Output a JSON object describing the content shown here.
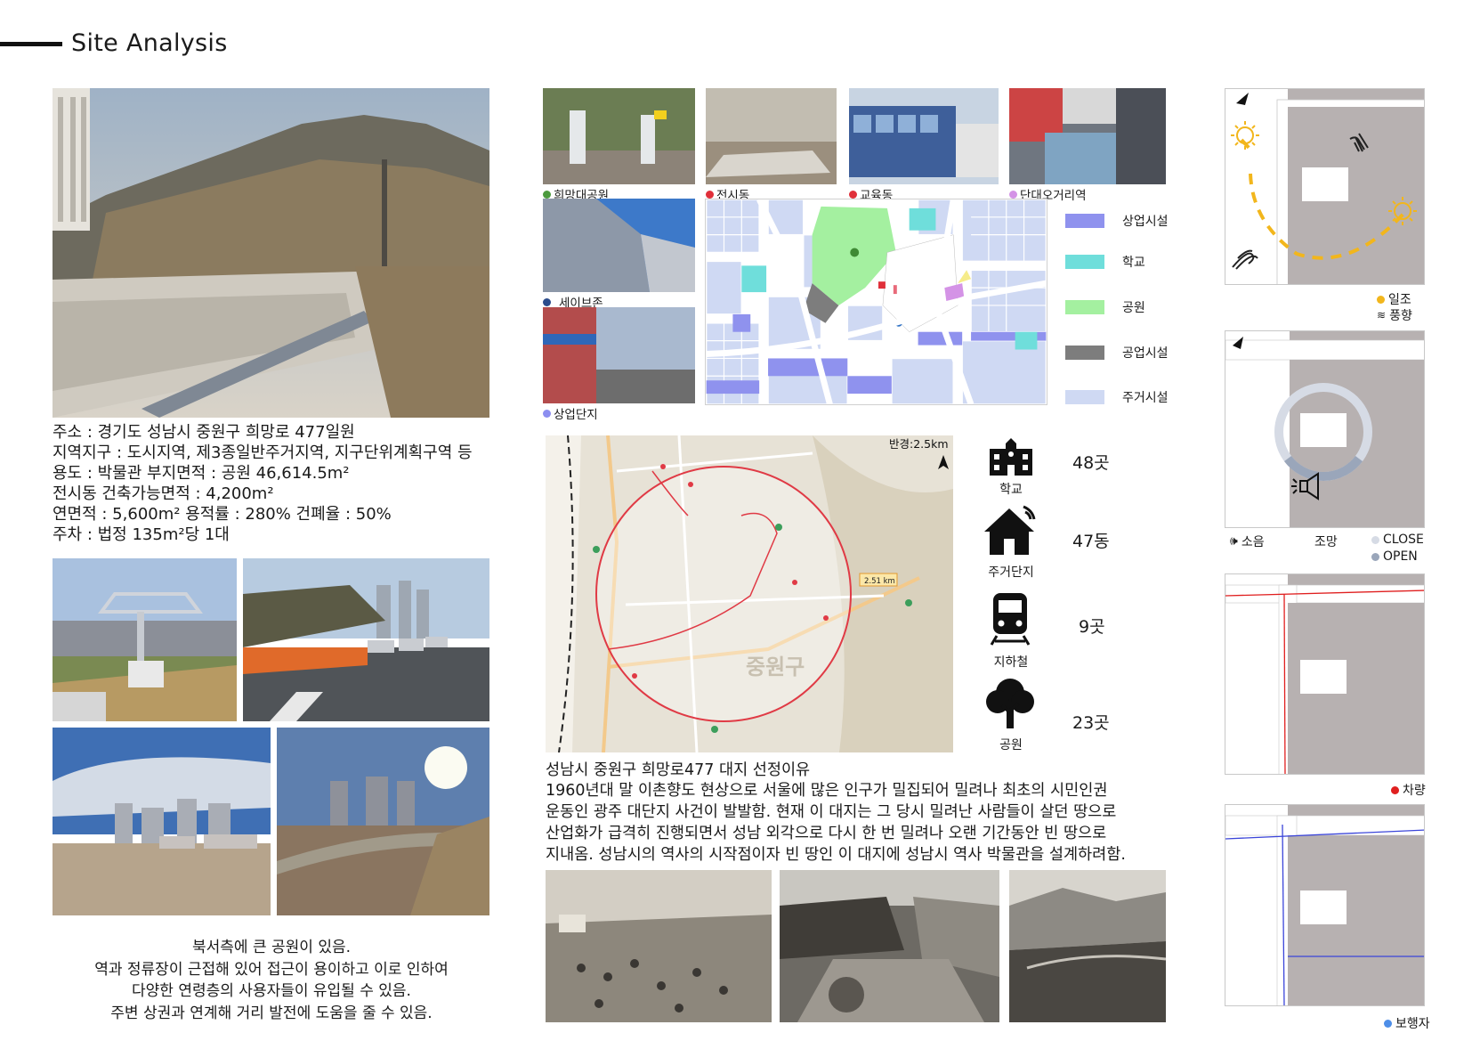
{
  "header": {
    "title": "Site Analysis"
  },
  "site_info": {
    "line1": "주소 : 경기도 성남시 중원구 희망로 477일원",
    "line2": "지역지구 : 도시지역, 제3종일반주거지역, 지구단위계획구역 등",
    "line3": "용도 : 박물관  부지면적 : 공원 46,614.5m²",
    "line4": "전시동 건축가능면적 : 4,200m²",
    "line5": "연면적 : 5,600m²    용적률 : 280%    건폐율 : 50%",
    "line6": "주차 : 법정 135m²당 1대"
  },
  "left_caption": {
    "line1": "북서측에 큰 공원이 있음.",
    "line2": "역과 정류장이 근접해 있어 접근이 용이하고 이로 인하여",
    "line3": "다양한 연령층의 사용자들이 유입될 수 있음.",
    "line4": "주변 상권과 연계해 거리 발전에 도움을 줄 수 있음."
  },
  "context_photos": {
    "p1": {
      "label": "희망대공원",
      "dot": "#4c9a3e"
    },
    "p2": {
      "label": "전시동",
      "dot": "#e0303a"
    },
    "p3": {
      "label": "교육동",
      "dot": "#e0303a"
    },
    "p4": {
      "label": "단대오거리역",
      "dot": "#d493e6"
    },
    "p5": {
      "label": "세이브존",
      "dot": "#2b4c8c"
    },
    "p6": {
      "label": "상업단지",
      "dot": "#8c8ef0"
    }
  },
  "landuse_legend": [
    {
      "label": "상업시설",
      "color": "#8f92ee"
    },
    {
      "label": "학교",
      "color": "#6fdedb"
    },
    {
      "label": "공원",
      "color": "#a4f0a0"
    },
    {
      "label": "공업시설",
      "color": "#7d7d7d"
    },
    {
      "label": "주거시설",
      "color": "#cfd9f3"
    }
  ],
  "radius_map": {
    "radius_label": "반경:2.5km",
    "distance_tag": "2.51 km",
    "district": "중원구"
  },
  "facilities": [
    {
      "label": "학교",
      "value": "48곳",
      "icon": "school-icon"
    },
    {
      "label": "주거단지",
      "value": "47동",
      "icon": "house-icon"
    },
    {
      "label": "지하철",
      "value": "9곳",
      "icon": "train-icon"
    },
    {
      "label": "공원",
      "value": "23곳",
      "icon": "tree-icon"
    }
  ],
  "reason": {
    "title": "성남시 중원구 희망로477 대지 선정이유",
    "line1": "1960년대 말 이촌향도 현상으로 서울에 많은 인구가 밀집되어 밀려나 최초의 시민인권",
    "line2": "운동인 광주 대단지 사건이 발발함. 현재 이 대지는 그 당시 밀려난 사람들이 살던 땅으로",
    "line3": "산업화가 급격히 진행되면서 성남 외각으로 다시 한 번 밀려나 오랜 기간동안 빈 땅으로",
    "line4": "지내옴. 성남시의 역사의 시작점이자 빈 땅인 이 대지에 성남시 역사 박물관을 설계하려함."
  },
  "diagrams": {
    "sun": {
      "label1": "일조",
      "label2": "풍향",
      "dot1": "#f2b61c"
    },
    "noise": {
      "noise_label": "소음",
      "view_label": "조망",
      "close_label": "CLOSE",
      "open_label": "OPEN",
      "close_color": "#d6dbe5",
      "open_color": "#9aa6ba"
    },
    "vehicle": {
      "label": "차량",
      "dot": "#e01f1f"
    },
    "pedestrian": {
      "label": "보행자",
      "dot": "#4d8ee8"
    }
  }
}
